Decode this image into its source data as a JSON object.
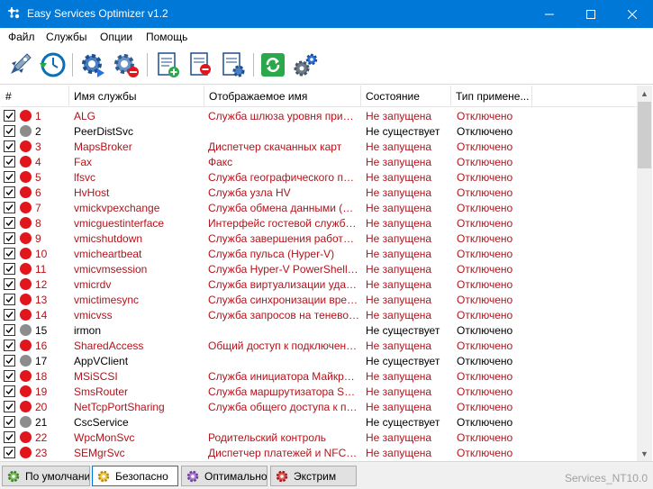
{
  "window": {
    "title": "Easy Services Optimizer v1.2"
  },
  "menu": [
    "Файл",
    "Службы",
    "Опции",
    "Помощь"
  ],
  "toolbar": [
    "optimize-rocket",
    "restore-clock",
    "start-service-gear",
    "stop-service-gear",
    "add-service-doc",
    "remove-service-doc",
    "edit-service-doc",
    "refresh",
    "settings-gears"
  ],
  "columns": [
    "#",
    "Имя службы",
    "Отображаемое имя",
    "Состояние",
    "Тип примене..."
  ],
  "rows": [
    {
      "num": "1",
      "name": "ALG",
      "display": "Служба шлюза уровня прило...",
      "state": "Не запущена",
      "type": "Отключено",
      "status": "red"
    },
    {
      "num": "2",
      "name": "PeerDistSvc",
      "display": "",
      "state": "Не существует",
      "type": "Отключено",
      "status": "gray"
    },
    {
      "num": "3",
      "name": "MapsBroker",
      "display": "Диспетчер скачанных карт",
      "state": "Не запущена",
      "type": "Отключено",
      "status": "red"
    },
    {
      "num": "4",
      "name": "Fax",
      "display": "Факс",
      "state": "Не запущена",
      "type": "Отключено",
      "status": "red"
    },
    {
      "num": "5",
      "name": "lfsvc",
      "display": "Служба географического пол...",
      "state": "Не запущена",
      "type": "Отключено",
      "status": "red"
    },
    {
      "num": "6",
      "name": "HvHost",
      "display": "Служба узла HV",
      "state": "Не запущена",
      "type": "Отключено",
      "status": "red"
    },
    {
      "num": "7",
      "name": "vmickvpexchange",
      "display": "Служба обмена данными (Hy...",
      "state": "Не запущена",
      "type": "Отключено",
      "status": "red"
    },
    {
      "num": "8",
      "name": "vmicguestinterface",
      "display": "Интерфейс гостевой службы ...",
      "state": "Не запущена",
      "type": "Отключено",
      "status": "red"
    },
    {
      "num": "9",
      "name": "vmicshutdown",
      "display": "Служба завершения работы ...",
      "state": "Не запущена",
      "type": "Отключено",
      "status": "red"
    },
    {
      "num": "10",
      "name": "vmicheartbeat",
      "display": "Служба пульса (Hyper-V)",
      "state": "Не запущена",
      "type": "Отключено",
      "status": "red"
    },
    {
      "num": "11",
      "name": "vmicvmsession",
      "display": "Служба Hyper-V PowerShell Di...",
      "state": "Не запущена",
      "type": "Отключено",
      "status": "red"
    },
    {
      "num": "12",
      "name": "vmicrdv",
      "display": "Служба виртуализации удал...",
      "state": "Не запущена",
      "type": "Отключено",
      "status": "red"
    },
    {
      "num": "13",
      "name": "vmictimesync",
      "display": "Служба синхронизации време...",
      "state": "Не запущена",
      "type": "Отключено",
      "status": "red"
    },
    {
      "num": "14",
      "name": "vmicvss",
      "display": "Служба запросов на теневое ...",
      "state": "Не запущена",
      "type": "Отключено",
      "status": "red"
    },
    {
      "num": "15",
      "name": "irmon",
      "display": "",
      "state": "Не существует",
      "type": "Отключено",
      "status": "gray"
    },
    {
      "num": "16",
      "name": "SharedAccess",
      "display": "Общий доступ к подключени...",
      "state": "Не запущена",
      "type": "Отключено",
      "status": "red"
    },
    {
      "num": "17",
      "name": "AppVClient",
      "display": "",
      "state": "Не существует",
      "type": "Отключено",
      "status": "gray"
    },
    {
      "num": "18",
      "name": "MSiSCSI",
      "display": "Служба инициатора Майкрос...",
      "state": "Не запущена",
      "type": "Отключено",
      "status": "red"
    },
    {
      "num": "19",
      "name": "SmsRouter",
      "display": "Служба маршрутизатора SMS...",
      "state": "Не запущена",
      "type": "Отключено",
      "status": "red"
    },
    {
      "num": "20",
      "name": "NetTcpPortSharing",
      "display": "Служба общего доступа к по...",
      "state": "Не запущена",
      "type": "Отключено",
      "status": "red"
    },
    {
      "num": "21",
      "name": "CscService",
      "display": "",
      "state": "Не существует",
      "type": "Отключено",
      "status": "gray"
    },
    {
      "num": "22",
      "name": "WpcMonSvc",
      "display": "Родительский контроль",
      "state": "Не запущена",
      "type": "Отключено",
      "status": "red"
    },
    {
      "num": "23",
      "name": "SEMgrSvc",
      "display": "Диспетчер платежей и NFC/з...",
      "state": "Не запущена",
      "type": "Отключено",
      "status": "red"
    }
  ],
  "presets": [
    "По умолчани",
    "Безопасно",
    "Оптимально",
    "Экстрим"
  ],
  "active_preset": "Безопасно",
  "version": "Services_NT10.0",
  "colors": {
    "titlebar": "#0078d7",
    "red_dot": "#e0161c",
    "gray_dot": "#8c8c8c",
    "service_red": "#b3131b"
  }
}
